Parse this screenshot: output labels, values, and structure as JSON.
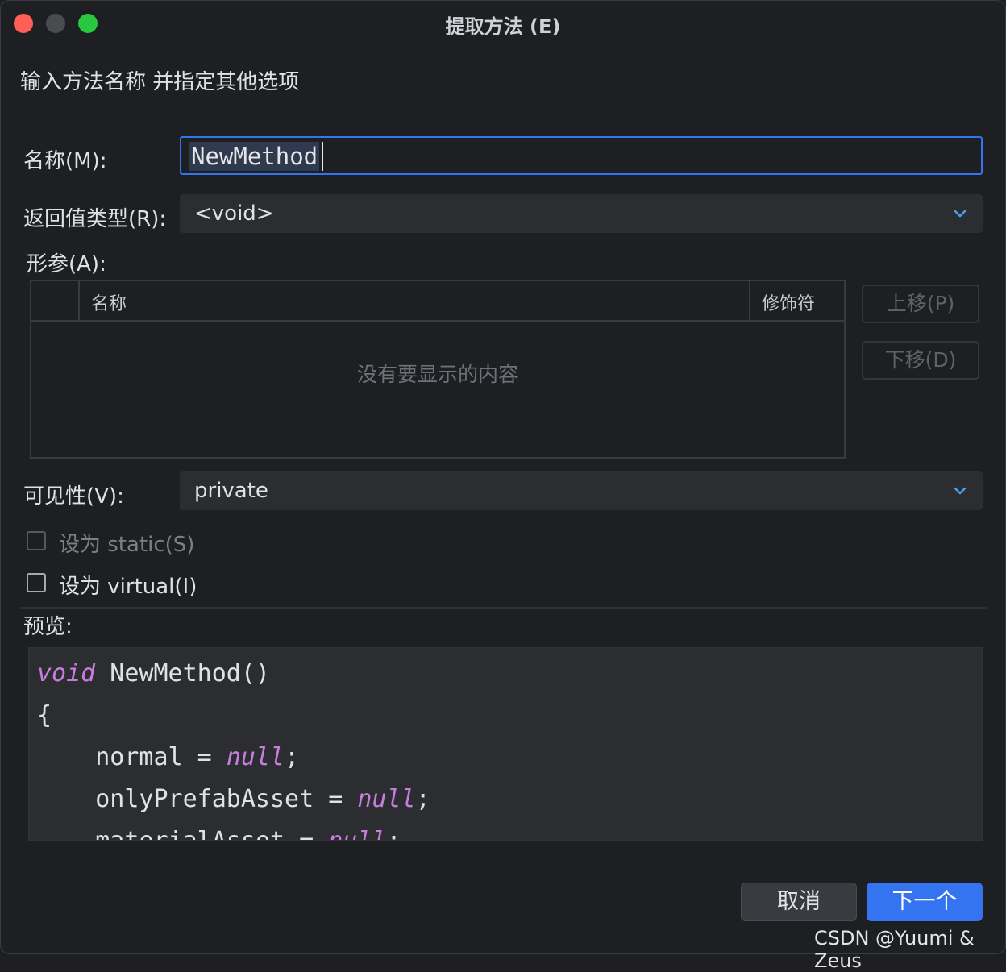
{
  "window": {
    "title": "提取方法 (E)"
  },
  "dialog": {
    "subtitle": "输入方法名称 并指定其他选项",
    "name": {
      "label": "名称(M):",
      "value": "NewMethod"
    },
    "return_type": {
      "label": "返回值类型(R):",
      "value": "<void>"
    },
    "params": {
      "label": "形参(A):",
      "columns": [
        "",
        "名称",
        "修饰符"
      ],
      "empty_text": "没有要显示的内容",
      "move_up": "上移(P)",
      "move_down": "下移(D)"
    },
    "visibility": {
      "label": "可见性(V):",
      "value": "private"
    },
    "make_static": {
      "label": "设为 static(S)",
      "checked": false,
      "enabled": false
    },
    "make_virtual": {
      "label": "设为 virtual(I)",
      "checked": false,
      "enabled": true
    },
    "preview": {
      "label": "预览:",
      "lines": [
        [
          {
            "t": "void",
            "k": true
          },
          {
            "t": " NewMethod()"
          }
        ],
        [
          {
            "t": "{"
          }
        ],
        [
          {
            "t": "    normal = "
          },
          {
            "t": "null",
            "k": true
          },
          {
            "t": ";"
          }
        ],
        [
          {
            "t": "    onlyPrefabAsset = "
          },
          {
            "t": "null",
            "k": true
          },
          {
            "t": ";"
          }
        ],
        [
          {
            "t": "    materialAsset = "
          },
          {
            "t": "null",
            "k": true
          },
          {
            "t": ";"
          }
        ]
      ]
    },
    "buttons": {
      "cancel": "取消",
      "next": "下一个"
    }
  },
  "watermark": "CSDN @Yuumi & Zeus",
  "colors": {
    "accent": "#3574f0",
    "keyword": "#c77dde",
    "background": "#1e1f22"
  }
}
